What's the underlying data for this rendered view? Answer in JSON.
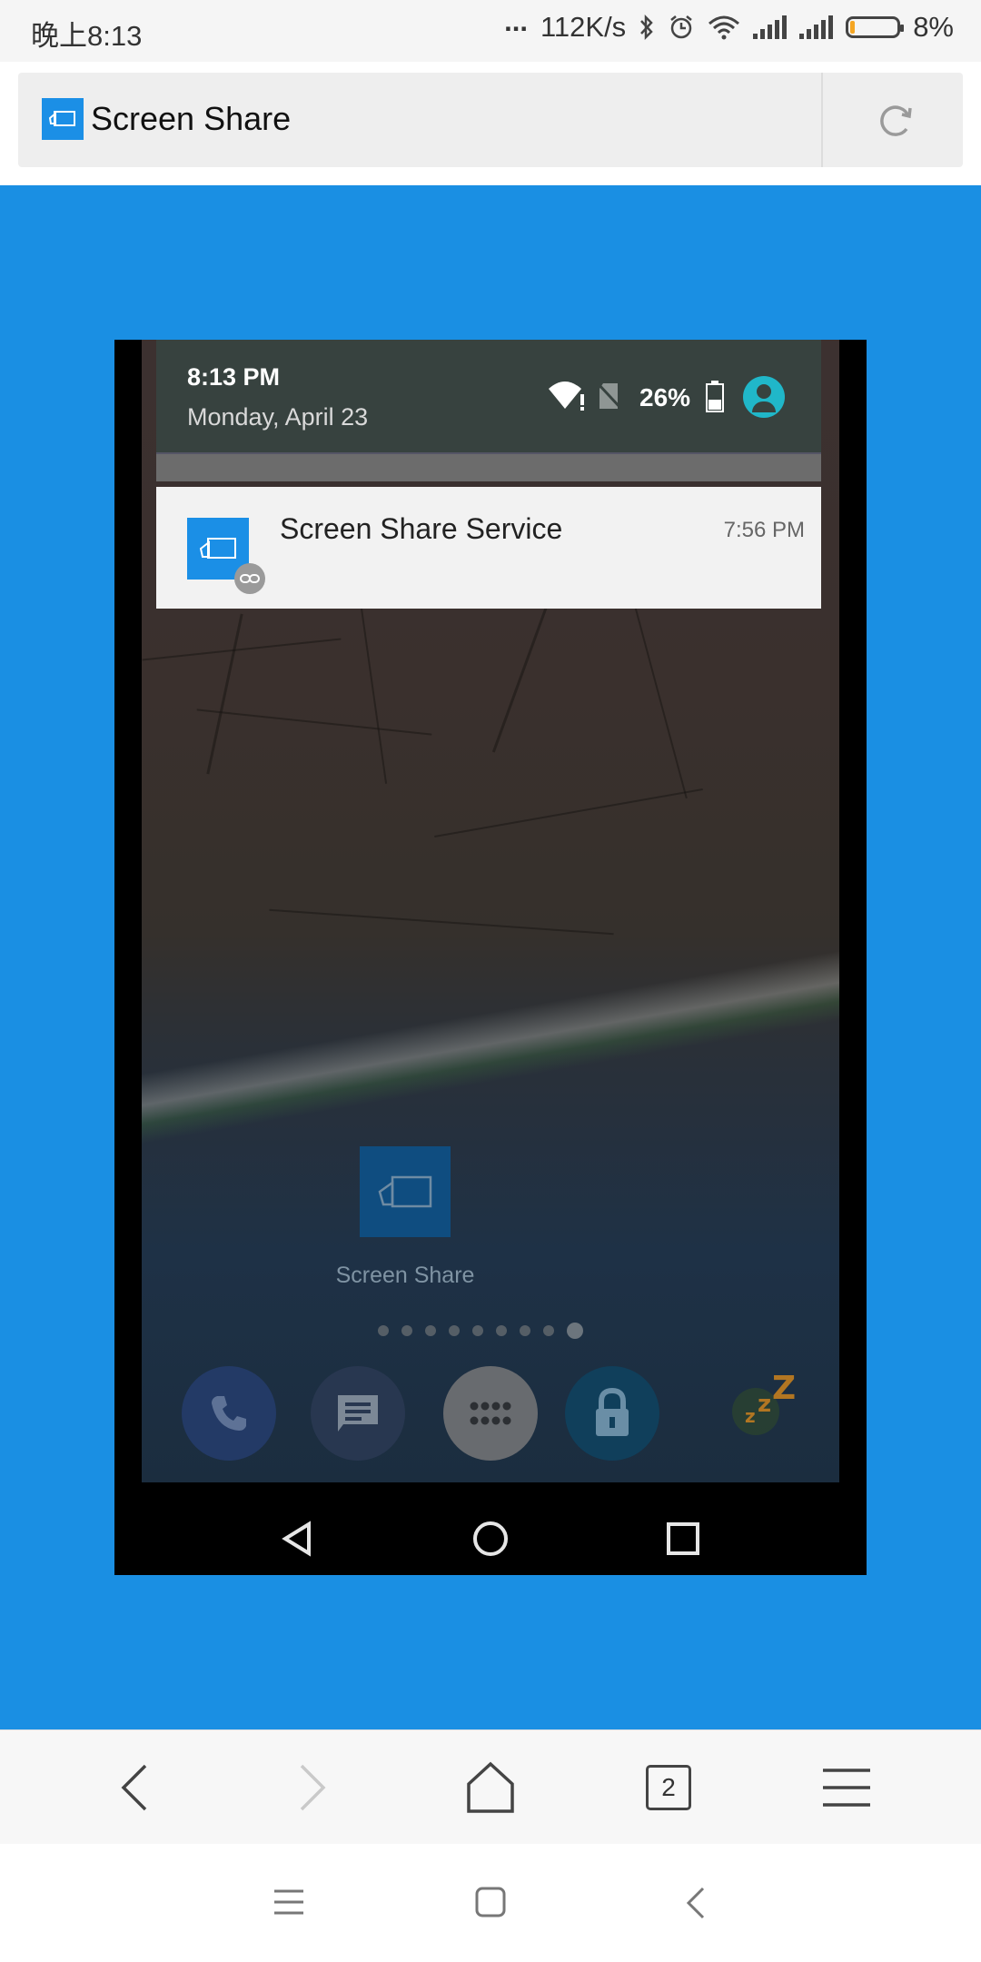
{
  "status_bar": {
    "time": "晚上8:13",
    "dots": "...",
    "speed": "112K/s",
    "battery": "8%",
    "icons": [
      "bluetooth-icon",
      "alarm-icon",
      "wifi-icon",
      "signal-icon",
      "signal-icon",
      "battery-icon"
    ]
  },
  "browser": {
    "tab_title": "Screen Share",
    "reload_icon": "reload-icon",
    "toolbar": {
      "back_icon": "back-arrow-icon",
      "forward_icon": "forward-arrow-icon",
      "home_icon": "home-icon",
      "tabs_count": "2",
      "menu_icon": "menu-icon"
    }
  },
  "remote_screen": {
    "shade": {
      "time": "8:13 PM",
      "date": "Monday, April 23",
      "battery": "26%"
    },
    "notification": {
      "title": "Screen Share Service",
      "time": "7:56 PM"
    },
    "home": {
      "app_label": "Screen Share",
      "page_dots": 9,
      "current_page": 9,
      "dock_icons": [
        "phone-icon",
        "messages-icon",
        "app-drawer-icon",
        "lock-icon",
        "sleep-icon"
      ]
    },
    "nav_icons": [
      "back-icon",
      "home-icon",
      "recents-icon"
    ]
  },
  "system_nav": {
    "icons": [
      "menu-icon",
      "home-icon",
      "back-icon"
    ]
  },
  "colors": {
    "page_blue": "#1a8fe3",
    "app_blue": "#1b8fe6",
    "shade": "#37423f",
    "avatar": "#20b7c9"
  }
}
